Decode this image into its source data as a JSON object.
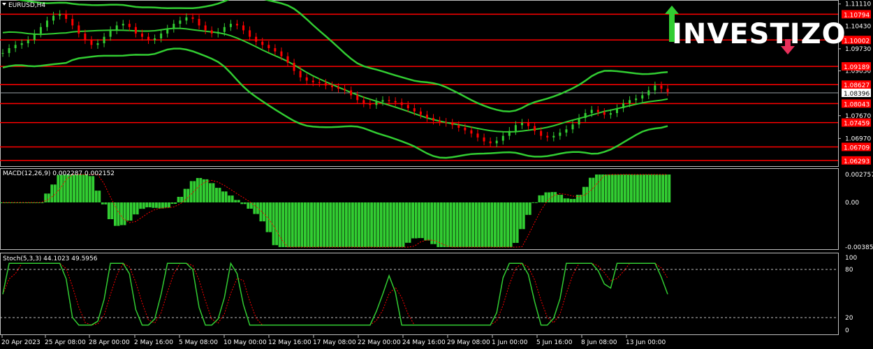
{
  "symbol": "EURUSD,H4",
  "price": {
    "ticks": [
      "1.11110",
      "1.10430",
      "1.09730",
      "1.09050",
      "1.07670",
      "1.06970"
    ],
    "range": [
      1.0616,
      1.1119
    ],
    "current": "1.08396",
    "levels": [
      "1.10794",
      "1.10002",
      "1.09189",
      "1.08627",
      "1.08043",
      "1.07459",
      "1.06709",
      "1.06293"
    ]
  },
  "macd": {
    "title": "MACD(12,26,9) 0.002287 0.002152",
    "ticks": [
      "0.002757",
      "0.00",
      "-0.003856"
    ]
  },
  "stoch": {
    "title": "Stoch(5,3,3) 44.1023 49.5956",
    "ticks": [
      "100",
      "80",
      "20",
      "0"
    ]
  },
  "time_labels": [
    "20 Apr 2023",
    "25 Apr 08:00",
    "28 Apr 00:00",
    "2 May 16:00",
    "5 May 08:00",
    "10 May 00:00",
    "12 May 16:00",
    "17 May 08:00",
    "22 May 00:00",
    "24 May 16:00",
    "29 May 08:00",
    "1 Jun 00:00",
    "5 Jun 16:00",
    "8 Jun 08:00",
    "13 Jun 00:00"
  ],
  "logo": "INVESTIZO",
  "colors": {
    "background": "#000000",
    "level_line": "#ff0000",
    "bollinger": "#32cd32",
    "macd_hist": "#32cd32",
    "signal": "#ff0000",
    "candle_up": "#32cd32",
    "candle_down": "#ff0000",
    "arrow_up": "#32cd32",
    "arrow_down": "#e8305a"
  },
  "chart_data": {
    "type": "candlestick",
    "price_series": [
      1.096,
      1.0975,
      1.0985,
      1.099,
      1.1,
      1.102,
      1.104,
      1.106,
      1.1075,
      1.108,
      1.1065,
      1.1045,
      1.102,
      1.1,
      1.0985,
      1.099,
      1.101,
      1.103,
      1.1045,
      1.105,
      1.104,
      1.102,
      1.101,
      1.1,
      1.1005,
      1.102,
      1.1035,
      1.105,
      1.106,
      1.107,
      1.1065,
      1.1045,
      1.103,
      1.102,
      1.1025,
      1.104,
      1.105,
      1.1045,
      1.103,
      1.101,
      1.0995,
      1.0985,
      1.0975,
      1.0965,
      1.095,
      1.093,
      1.0905,
      1.0885,
      1.0875,
      1.087,
      1.0868,
      1.086,
      1.0855,
      1.085,
      1.0845,
      1.083,
      1.0815,
      1.0805,
      1.08,
      1.081,
      1.0815,
      1.0812,
      1.0808,
      1.08,
      1.079,
      1.078,
      1.077,
      1.076,
      1.0752,
      1.0748,
      1.0745,
      1.0738,
      1.073,
      1.0722,
      1.0712,
      1.07,
      1.0688,
      1.0682,
      1.069,
      1.0705,
      1.072,
      1.0738,
      1.0745,
      1.0735,
      1.072,
      1.0705,
      1.07,
      1.0705,
      1.0715,
      1.0725,
      1.074,
      1.076,
      1.0775,
      1.0785,
      1.0778,
      1.077,
      1.0775,
      1.079,
      1.0805,
      1.0815,
      1.082,
      1.083,
      1.0845,
      1.086,
      1.085,
      1.084
    ],
    "x_range": [
      "20 Apr 2023",
      "14 Jun"
    ],
    "y_range": [
      1.0616,
      1.1119
    ],
    "indicators": [
      "Bollinger Bands",
      "MACD(12,26,9)",
      "Stoch(5,3,3)"
    ]
  }
}
